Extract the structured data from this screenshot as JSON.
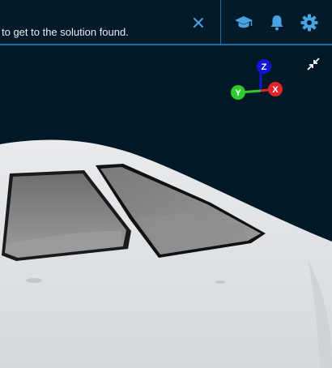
{
  "notification": {
    "message": "to get to the solution found."
  },
  "toolbar": {
    "icons": [
      "close-icon",
      "graduation-cap-icon",
      "bell-icon",
      "gear-icon"
    ],
    "accent_color": "#4aa3e0"
  },
  "viewport": {
    "background_color": "#021a2a",
    "gizmo": {
      "z_label": "Z",
      "y_label": "Y",
      "x_label": "X",
      "z_color": "#1414d6",
      "y_color": "#2ecc2e",
      "x_color": "#e0262a"
    }
  }
}
